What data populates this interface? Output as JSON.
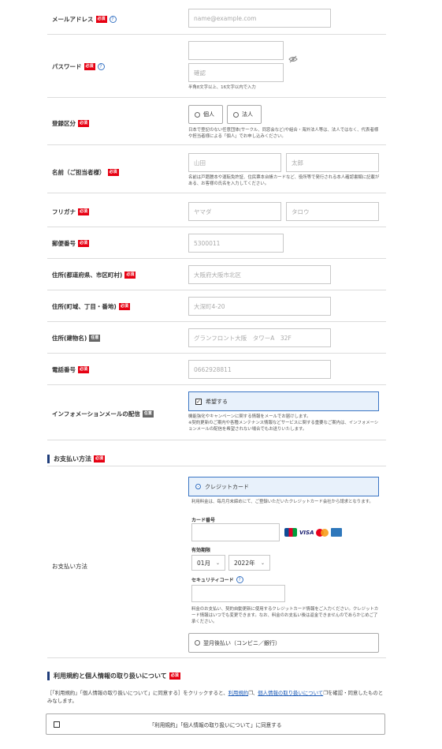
{
  "fields": {
    "email": {
      "label": "メールアドレス",
      "req": "必須",
      "placeholder": "name@example.com"
    },
    "password": {
      "label": "パスワード",
      "req": "必須",
      "confirm": "確認",
      "note": "半角8文字以上、16文字以内で入力"
    },
    "registration": {
      "label": "登録区分",
      "req": "必須",
      "options": [
        "個人",
        "法人"
      ],
      "note": "日本で登記のない任意団体(サークル、同窓会など)や組合・海外法人等は、法人ではなく、代表者様や担当者様による「個人」でお申し込みください。"
    },
    "name": {
      "label": "名前（ご担当者様）",
      "req": "必須",
      "last": "山田",
      "first": "太郎",
      "note": "名前は戸籍謄本や運転免許証、住民票本台帳カードなど、役所等で発行される本人確認書類に記載がある、お客様の氏名を入力してください。"
    },
    "furigana": {
      "label": "フリガナ",
      "req": "必須",
      "last": "ヤマダ",
      "first": "タロウ"
    },
    "postal": {
      "label": "郵便番号",
      "req": "必須",
      "value": "5300011"
    },
    "address1": {
      "label": "住所(都道府県、市区町村)",
      "req": "必須",
      "value": "大阪府大阪市北区"
    },
    "address2": {
      "label": "住所(町域、丁目・番地)",
      "req": "必須",
      "value": "大深町4-20"
    },
    "address3": {
      "label": "住所(建物名)",
      "opt": "任意",
      "value": "グランフロント大阪　タワーA　32F"
    },
    "phone": {
      "label": "電話番号",
      "req": "必須",
      "value": "0662928811"
    },
    "newsletter": {
      "label": "インフォメーションメールの配信",
      "opt": "任意",
      "option": "希望する",
      "note1": "機能強化やキャンペーンに関する情報をメールでお届けします。",
      "note2": "※契約更新のご案内や各種メンテナンス情報などサービスに関する重要なご案内は、インフォメーションメールの配信を希望されない場合でもお送りいたします。"
    }
  },
  "payment": {
    "section_title": "お支払い方法",
    "req": "必須",
    "label": "お支払い方法",
    "credit": "クレジットカード",
    "credit_note": "利用料金は、毎月月末締めにて、ご登録いただいたクレジットカード会社から請求となります。",
    "card_number_label": "カード番号",
    "brands": [
      "JCB",
      "VISA",
      "MC",
      "AMEX"
    ],
    "expiry_label": "有効期限",
    "month": "01月",
    "year": "2022年",
    "cvc_label": "セキュリティコード",
    "cvc_note": "料金のお支払い、契約自動更新に使用するクレジットカード情報をご入力ください。クレジットカード情報はいつでも変更できます。なお、料金のお支払い後は返金できませんのであらかじめご了承ください。",
    "deferred": "翌月後払い（コンビニ／銀行）"
  },
  "terms": {
    "title": "利用規約と個人情報の取り扱いについて",
    "req": "必須",
    "text_pre": "［「利用規約」「個人情報の取り扱いについて」に同意する］をクリックすると、",
    "link1": "利用規約",
    "sep": "、",
    "link2": "個人情報の取り扱いについて",
    "text_post": "を確認・同意したものとみなします。",
    "agree": "「利用規約」「個人情報の取り扱いについて」に同意する"
  }
}
